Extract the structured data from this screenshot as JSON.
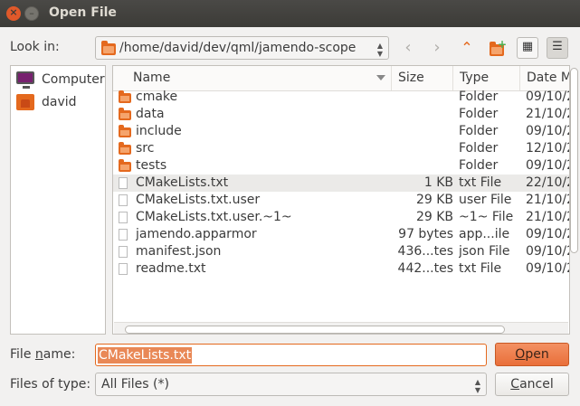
{
  "window": {
    "title": "Open File"
  },
  "look_in": {
    "label": "Look in:",
    "path": "/home/david/dev/qml/jamendo-scope"
  },
  "toolbar": {
    "back_icon": "arrow-left-icon",
    "forward_icon": "arrow-right-icon",
    "up_icon": "arrow-up-icon",
    "new_folder_icon": "new-folder-icon",
    "icon_view_icon": "icon-view-icon",
    "list_view_icon": "list-view-icon"
  },
  "sidebar": {
    "items": [
      {
        "label": "Computer",
        "icon": "computer-icon"
      },
      {
        "label": "david",
        "icon": "home-folder-icon"
      }
    ]
  },
  "file_list": {
    "columns": [
      "Name",
      "Size",
      "Type",
      "Date M"
    ],
    "rows": [
      {
        "name": "cmake",
        "size": "",
        "type": "Folder",
        "date": "09/10/2",
        "kind": "folder"
      },
      {
        "name": "data",
        "size": "",
        "type": "Folder",
        "date": "21/10/2",
        "kind": "folder"
      },
      {
        "name": "include",
        "size": "",
        "type": "Folder",
        "date": "09/10/2",
        "kind": "folder"
      },
      {
        "name": "src",
        "size": "",
        "type": "Folder",
        "date": "12/10/2",
        "kind": "folder"
      },
      {
        "name": "tests",
        "size": "",
        "type": "Folder",
        "date": "09/10/2",
        "kind": "folder"
      },
      {
        "name": "CMakeLists.txt",
        "size": "1 KB",
        "type": "txt File",
        "date": "22/10/2",
        "kind": "file",
        "selected": true
      },
      {
        "name": "CMakeLists.txt.user",
        "size": "29 KB",
        "type": "user File",
        "date": "21/10/2",
        "kind": "file"
      },
      {
        "name": "CMakeLists.txt.user.~1~",
        "size": "29 KB",
        "type": "~1~ File",
        "date": "21/10/2",
        "kind": "file"
      },
      {
        "name": "jamendo.apparmor",
        "size": "97 bytes",
        "type": "app...ile",
        "date": "09/10/2",
        "kind": "file"
      },
      {
        "name": "manifest.json",
        "size": "436...tes",
        "type": "json File",
        "date": "09/10/2",
        "kind": "file"
      },
      {
        "name": "readme.txt",
        "size": "442...tes",
        "type": "txt File",
        "date": "09/10/2",
        "kind": "file"
      }
    ]
  },
  "file_name": {
    "label_prefix": "File ",
    "label_accel": "n",
    "label_suffix": "ame:",
    "value": "CMakeLists.txt"
  },
  "files_of_type": {
    "label": "Files of type:",
    "value": "All Files (*)"
  },
  "buttons": {
    "open": {
      "accel": "O",
      "rest": "pen"
    },
    "cancel": {
      "accel": "C",
      "rest": "ancel"
    }
  }
}
